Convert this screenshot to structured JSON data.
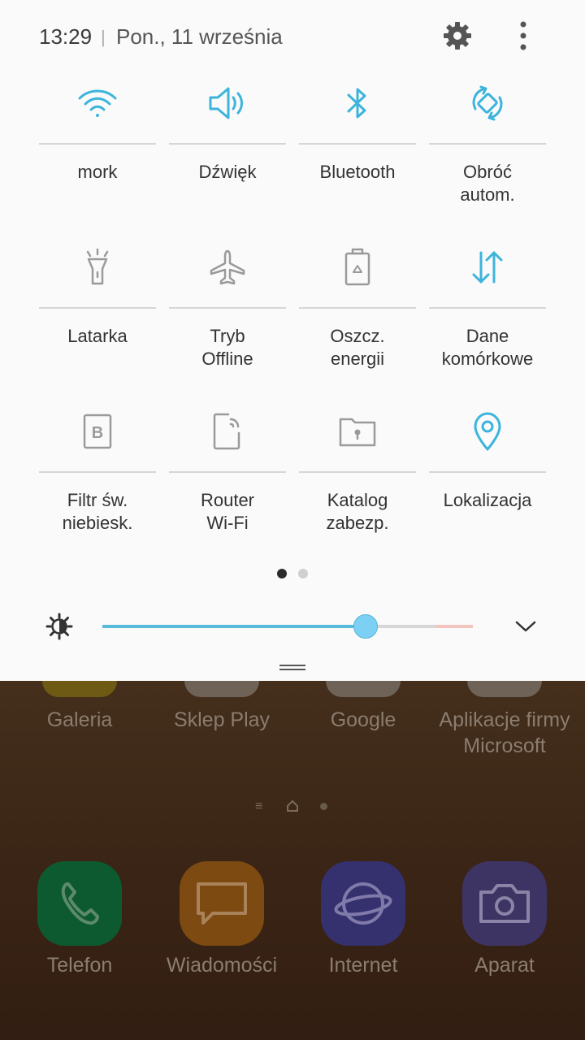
{
  "status": {
    "time": "13:29",
    "separator": "|",
    "date": "Pon., 11 września"
  },
  "quick_settings": [
    {
      "label": "mork",
      "icon": "wifi-icon",
      "active": true
    },
    {
      "label": "Dźwięk",
      "icon": "volume-icon",
      "active": true
    },
    {
      "label": "Bluetooth",
      "icon": "bluetooth-icon",
      "active": true
    },
    {
      "label": "Obróć\nautom.",
      "icon": "auto-rotate-icon",
      "active": true
    },
    {
      "label": "Latarka",
      "icon": "flashlight-icon",
      "active": false
    },
    {
      "label": "Tryb\nOffline",
      "icon": "airplane-icon",
      "active": false
    },
    {
      "label": "Oszcz.\nenergii",
      "icon": "battery-saver-icon",
      "active": false
    },
    {
      "label": "Dane\nkomórkowe",
      "icon": "mobile-data-icon",
      "active": true
    },
    {
      "label": "Filtr św.\nniebiesk.",
      "icon": "blue-light-filter-icon",
      "active": false
    },
    {
      "label": "Router\nWi-Fi",
      "icon": "hotspot-icon",
      "active": false
    },
    {
      "label": "Katalog\nzabezp.",
      "icon": "secure-folder-icon",
      "active": false
    },
    {
      "label": "Lokalizacja",
      "icon": "location-icon",
      "active": true
    }
  ],
  "pagination": {
    "page": 1,
    "pages": 2
  },
  "brightness": {
    "level": 0.71
  },
  "home": {
    "apps": [
      "Galeria",
      "Sklep Play",
      "Google",
      "Aplikacje firmy\nMicrosoft"
    ],
    "dock": [
      "Telefon",
      "Wiadomości",
      "Internet",
      "Aparat"
    ]
  },
  "colors": {
    "accent": "#3cb4dc",
    "inactive": "#9a9a9a",
    "shade": "#fafafa"
  }
}
